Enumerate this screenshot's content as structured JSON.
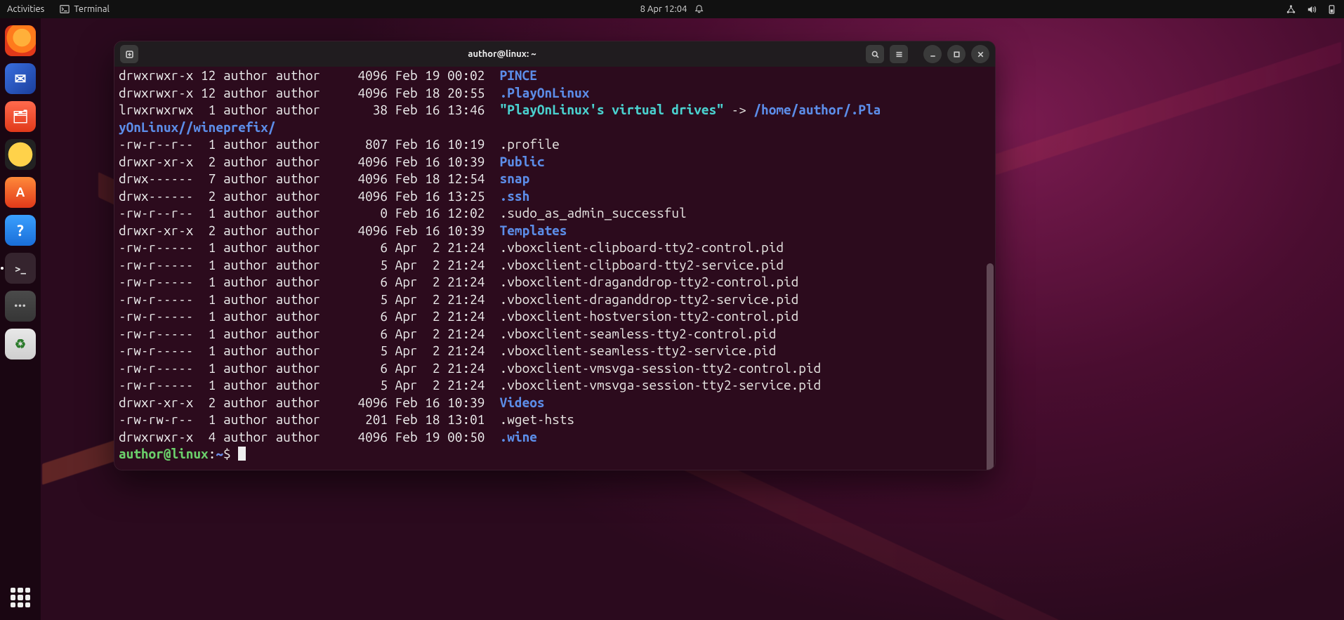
{
  "topbar": {
    "activities": "Activities",
    "app_label": "Terminal",
    "clock": "8 Apr  12:04"
  },
  "dock": {
    "items": [
      {
        "name": "firefox",
        "active": false
      },
      {
        "name": "thunderbird",
        "active": false
      },
      {
        "name": "files",
        "active": false
      },
      {
        "name": "rhythmbox",
        "active": false
      },
      {
        "name": "software",
        "active": false
      },
      {
        "name": "help",
        "active": false
      },
      {
        "name": "terminal",
        "active": true
      },
      {
        "name": "text-editor",
        "active": false
      },
      {
        "name": "trash",
        "active": false
      }
    ]
  },
  "window": {
    "title": "author@linux: ~"
  },
  "listing": {
    "symlink_target_prefix": "/home/author/.Pla",
    "symlink_target_wrap": "yOnLinux//wineprefix/",
    "arrow": " -> ",
    "rows": [
      {
        "perm": "drwxrwxr-x",
        "n": "12",
        "u": "author",
        "g": "author",
        "sz": "4096",
        "date": "Feb 19 00:02",
        "name": "PINCE",
        "kind": "dir"
      },
      {
        "perm": "drwxrwxr-x",
        "n": "12",
        "u": "author",
        "g": "author",
        "sz": "4096",
        "date": "Feb 18 20:55",
        "name": ".PlayOnLinux",
        "kind": "dir"
      },
      {
        "perm": "lrwxrwxrwx",
        "n": " 1",
        "u": "author",
        "g": "author",
        "sz": "38",
        "date": "Feb 16 13:46",
        "name": "\"PlayOnLinux's virtual drives\"",
        "kind": "link"
      },
      {
        "perm": "-rw-r--r--",
        "n": " 1",
        "u": "author",
        "g": "author",
        "sz": "807",
        "date": "Feb 16 10:19",
        "name": ".profile",
        "kind": "reg"
      },
      {
        "perm": "drwxr-xr-x",
        "n": " 2",
        "u": "author",
        "g": "author",
        "sz": "4096",
        "date": "Feb 16 10:39",
        "name": "Public",
        "kind": "dir"
      },
      {
        "perm": "drwx------",
        "n": " 7",
        "u": "author",
        "g": "author",
        "sz": "4096",
        "date": "Feb 18 12:54",
        "name": "snap",
        "kind": "dir"
      },
      {
        "perm": "drwx------",
        "n": " 2",
        "u": "author",
        "g": "author",
        "sz": "4096",
        "date": "Feb 16 13:25",
        "name": ".ssh",
        "kind": "dir"
      },
      {
        "perm": "-rw-r--r--",
        "n": " 1",
        "u": "author",
        "g": "author",
        "sz": "0",
        "date": "Feb 16 12:02",
        "name": ".sudo_as_admin_successful",
        "kind": "reg"
      },
      {
        "perm": "drwxr-xr-x",
        "n": " 2",
        "u": "author",
        "g": "author",
        "sz": "4096",
        "date": "Feb 16 10:39",
        "name": "Templates",
        "kind": "dir"
      },
      {
        "perm": "-rw-r-----",
        "n": " 1",
        "u": "author",
        "g": "author",
        "sz": "6",
        "date": "Apr  2 21:24",
        "name": ".vboxclient-clipboard-tty2-control.pid",
        "kind": "reg"
      },
      {
        "perm": "-rw-r-----",
        "n": " 1",
        "u": "author",
        "g": "author",
        "sz": "5",
        "date": "Apr  2 21:24",
        "name": ".vboxclient-clipboard-tty2-service.pid",
        "kind": "reg"
      },
      {
        "perm": "-rw-r-----",
        "n": " 1",
        "u": "author",
        "g": "author",
        "sz": "6",
        "date": "Apr  2 21:24",
        "name": ".vboxclient-draganddrop-tty2-control.pid",
        "kind": "reg"
      },
      {
        "perm": "-rw-r-----",
        "n": " 1",
        "u": "author",
        "g": "author",
        "sz": "5",
        "date": "Apr  2 21:24",
        "name": ".vboxclient-draganddrop-tty2-service.pid",
        "kind": "reg"
      },
      {
        "perm": "-rw-r-----",
        "n": " 1",
        "u": "author",
        "g": "author",
        "sz": "6",
        "date": "Apr  2 21:24",
        "name": ".vboxclient-hostversion-tty2-control.pid",
        "kind": "reg"
      },
      {
        "perm": "-rw-r-----",
        "n": " 1",
        "u": "author",
        "g": "author",
        "sz": "6",
        "date": "Apr  2 21:24",
        "name": ".vboxclient-seamless-tty2-control.pid",
        "kind": "reg"
      },
      {
        "perm": "-rw-r-----",
        "n": " 1",
        "u": "author",
        "g": "author",
        "sz": "5",
        "date": "Apr  2 21:24",
        "name": ".vboxclient-seamless-tty2-service.pid",
        "kind": "reg"
      },
      {
        "perm": "-rw-r-----",
        "n": " 1",
        "u": "author",
        "g": "author",
        "sz": "6",
        "date": "Apr  2 21:24",
        "name": ".vboxclient-vmsvga-session-tty2-control.pid",
        "kind": "reg"
      },
      {
        "perm": "-rw-r-----",
        "n": " 1",
        "u": "author",
        "g": "author",
        "sz": "5",
        "date": "Apr  2 21:24",
        "name": ".vboxclient-vmsvga-session-tty2-service.pid",
        "kind": "reg"
      },
      {
        "perm": "drwxr-xr-x",
        "n": " 2",
        "u": "author",
        "g": "author",
        "sz": "4096",
        "date": "Feb 16 10:39",
        "name": "Videos",
        "kind": "dir"
      },
      {
        "perm": "-rw-rw-r--",
        "n": " 1",
        "u": "author",
        "g": "author",
        "sz": "201",
        "date": "Feb 18 13:01",
        "name": ".wget-hsts",
        "kind": "reg"
      },
      {
        "perm": "drwxrwxr-x",
        "n": " 4",
        "u": "author",
        "g": "author",
        "sz": "4096",
        "date": "Feb 19 00:50",
        "name": ".wine",
        "kind": "dir"
      }
    ]
  },
  "prompt": {
    "user": "author",
    "host": "linux",
    "path": "~",
    "sigil": "$"
  }
}
